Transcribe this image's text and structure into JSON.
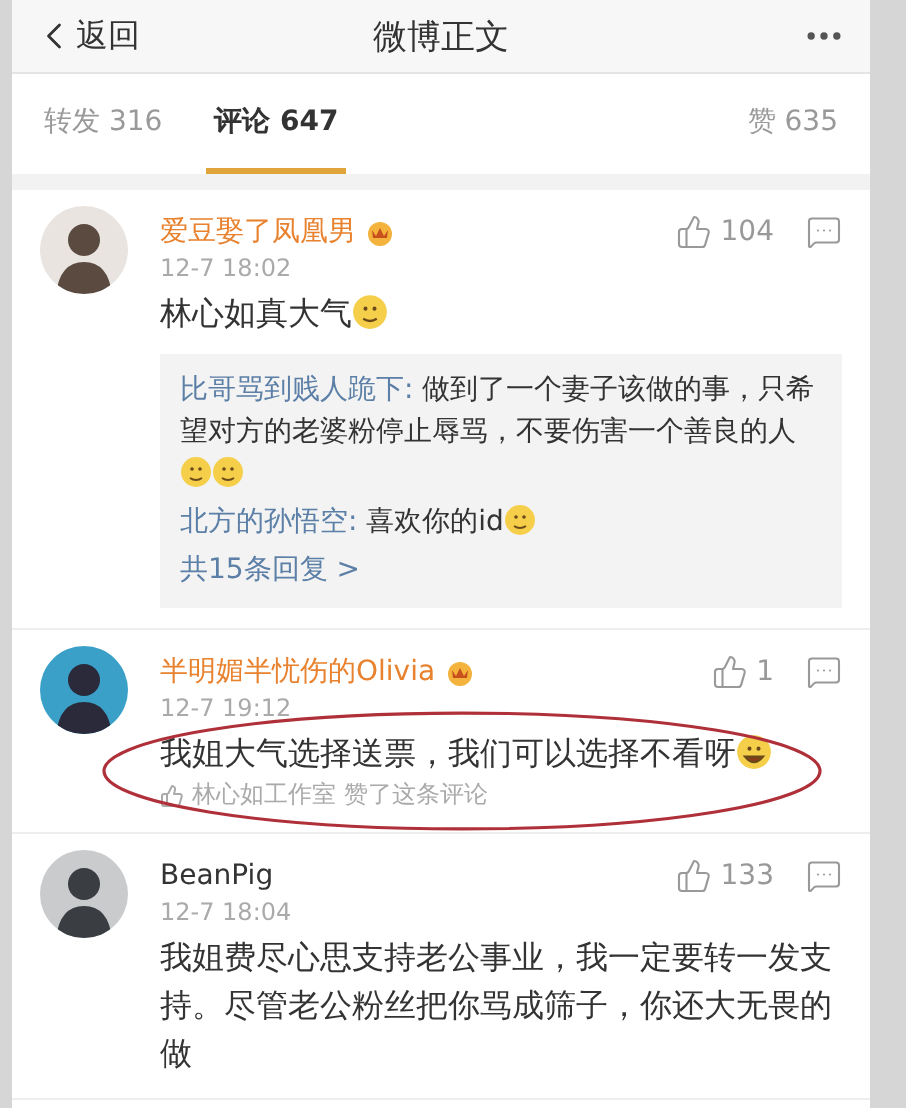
{
  "header": {
    "back": "返回",
    "title": "微博正文"
  },
  "tabs": [
    {
      "label": "转发 316",
      "selected": false
    },
    {
      "label": "评论 647",
      "selected": true
    },
    {
      "label": "赞 635",
      "selected": false
    }
  ],
  "comments": [
    {
      "name": "爱豆娶了凤凰男",
      "vip": true,
      "time": "12-7 18:02",
      "likes": "104",
      "text": "林心如真大气",
      "emojis": [
        {
          "kind": "smile"
        }
      ],
      "replies": [
        {
          "author": "比哥骂到贱人跪下:",
          "text": "做到了一个妻子该做的事，只希望对方的老婆粉停止辱骂，不要伤害一个善良的人",
          "emojis": [
            {
              "kind": "smile"
            },
            {
              "kind": "smile"
            }
          ]
        },
        {
          "author": "北方的孙悟空:",
          "text": "喜欢你的id",
          "emojis": [
            {
              "kind": "smile"
            }
          ]
        }
      ],
      "more_replies": "共15条回复 >"
    },
    {
      "name": "半明媚半忧伤的Olivia",
      "vip": true,
      "time": "12-7 19:12",
      "likes": "1",
      "text": "我姐大气选择送票，我们可以选择不看呀",
      "emojis": [
        {
          "kind": "laugh"
        }
      ],
      "circled": true,
      "liked_by": "林心如工作室 赞了这条评论"
    },
    {
      "name": "BeanPig",
      "vip": false,
      "time": "12-7 18:04",
      "likes": "133",
      "text": "我姐费尽心思支持老公事业，我一定要转一发支持。尽管老公粉丝把你骂成筛子，你还大无畏的做"
    }
  ]
}
